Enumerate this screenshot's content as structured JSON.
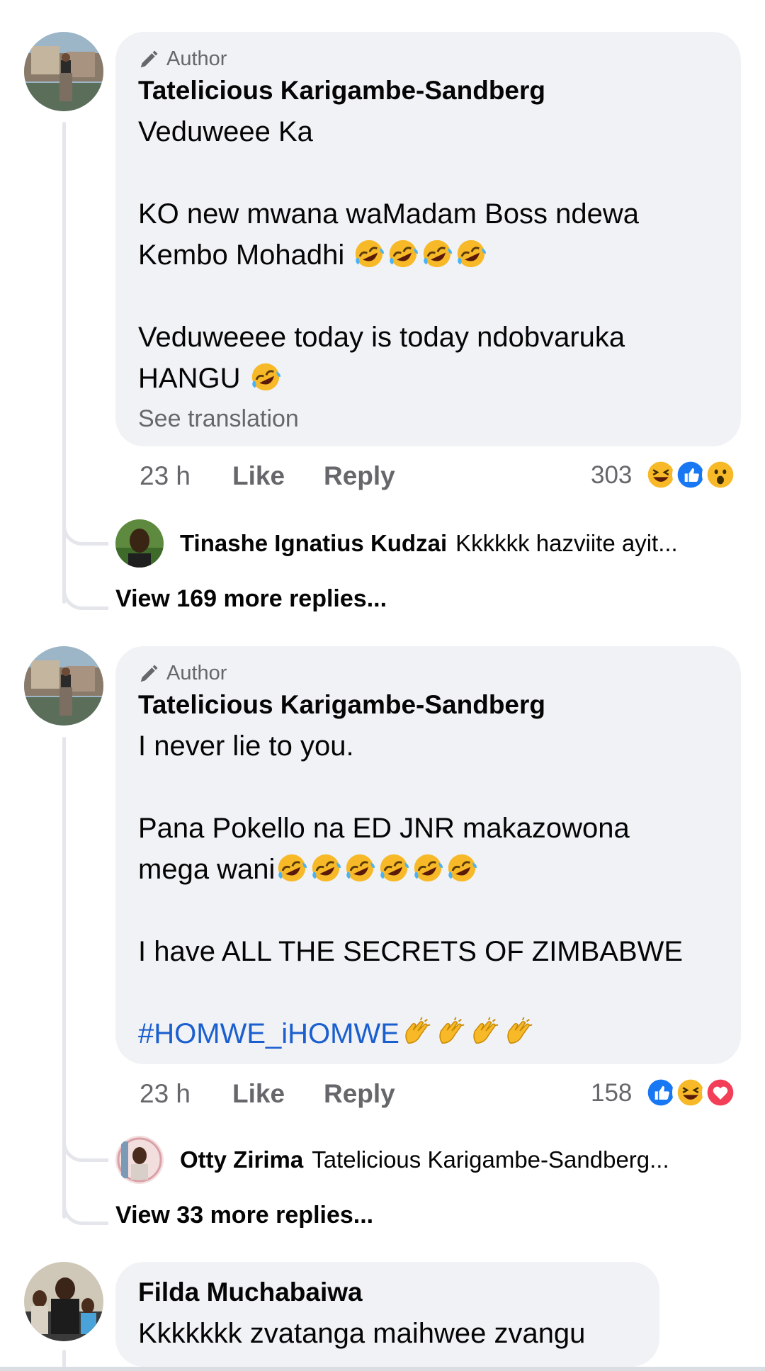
{
  "comments": [
    {
      "badge": "Author",
      "name": "Tatelicious Karigambe-Sandberg",
      "lines": [
        "Veduweee Ka",
        "",
        "KO new mwana waMadam Boss ndewa",
        "Kembo Mohadhi",
        "",
        "Veduweeee today is today ndobvaruka",
        "HANGU"
      ],
      "see_translation": "See translation",
      "time": "23 h",
      "like": "Like",
      "reply": "Reply",
      "reaction_count": "303",
      "reactions": [
        "laugh",
        "like",
        "wow"
      ],
      "reply_preview": {
        "name": "Tinashe Ignatius Kudzai",
        "text": "Kkkkkk hazviite ayit..."
      },
      "view_more": "View 169 more replies..."
    },
    {
      "badge": "Author",
      "name": "Tatelicious Karigambe-Sandberg",
      "lines": [
        "I never lie to you.",
        "",
        "Pana Pokello na ED JNR makazowona",
        "mega wani",
        "",
        "I have ALL THE SECRETS OF ZIMBABWE",
        "",
        "#HOMWE_iHOMWE"
      ],
      "time": "23 h",
      "like": "Like",
      "reply": "Reply",
      "reaction_count": "158",
      "reactions": [
        "like",
        "laugh",
        "love"
      ],
      "reply_preview": {
        "name": "Otty Zirima",
        "text": "Tatelicious Karigambe-Sandberg..."
      },
      "view_more": "View 33 more replies..."
    },
    {
      "name": "Filda Muchabaiwa",
      "text": "Kkkkkkk zvatanga maihwee zvangu"
    }
  ],
  "colors": {
    "bubble": "#f0f2f5",
    "meta": "#65676b",
    "link": "#1b5fcf",
    "thread": "#e4e6eb"
  },
  "icons": [
    "pencil-icon",
    "rofl-emoji",
    "clap-emoji",
    "laugh-reaction",
    "like-reaction",
    "wow-reaction",
    "love-reaction"
  ]
}
